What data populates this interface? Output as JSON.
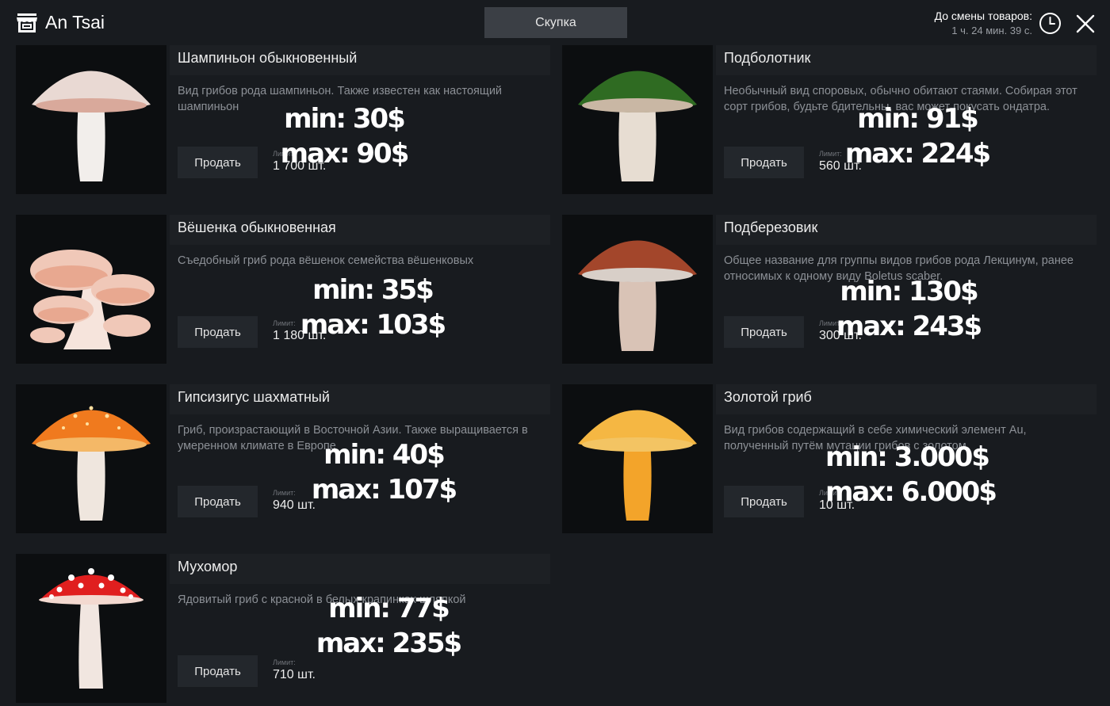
{
  "header": {
    "store_name": "An Tsai",
    "tab_label": "Скупка",
    "timer_label": "До смены товаров:",
    "timer_value": "1 ч. 24 мин. 39 с."
  },
  "icons": {
    "store": "store-icon",
    "clock": "clock-icon",
    "close": "close-icon"
  },
  "common": {
    "sell_label": "Продать",
    "limit_label": "Лимит:"
  },
  "items": [
    {
      "title": "Шампиньон обыкновенный",
      "description": "Вид грибов рода шампиньон. Также известен как настоящий шампиньон",
      "limit": "1 700 шт.",
      "min": "min: 30$",
      "max": "max: 90$",
      "cap_color": "#e9d9d3",
      "gill_color": "#d9a99b",
      "stem_color": "#f2eeeb",
      "image": "champignon"
    },
    {
      "title": "Подболотник",
      "description": "Необычный вид споровых, обычно обитают стаями. Собирая этот сорт грибов, будьте бдительны, вас может покусать ондатра.",
      "limit": "560 шт.",
      "min": "min: 91$",
      "max": "max: 224$",
      "cap_color": "#2f6b22",
      "gill_color": "#c9b7a4",
      "stem_color": "#e7ddd2",
      "image": "green-cap"
    },
    {
      "title": "Вёшенка обыкновенная",
      "description": "Съедобный гриб рода вёшенок семейства вёшенковых",
      "limit": "1 180 шт.",
      "min": "min: 35$",
      "max": "max: 103$",
      "cap_color": "#f0c8b8",
      "gill_color": "#e8a890",
      "stem_color": "#f6e4dc",
      "image": "oyster"
    },
    {
      "title": "Подберезовик",
      "description": "Общее название для группы видов грибов рода Лекцинум, ранее относимых к одному виду Boletus scaber.",
      "limit": "300 шт.",
      "min": "min: 130$",
      "max": "max: 243$",
      "cap_color": "#a3462b",
      "gill_color": "#d8cfc8",
      "stem_color": "#d9c3b6",
      "image": "birch-bolete"
    },
    {
      "title": "Гипсизигус шахматный",
      "description": "Гриб, произрастающий в Восточной Азии. Также выращивается в умеренном климате в Европе",
      "limit": "940 шт.",
      "min": "min: 40$",
      "max": "max: 107$",
      "cap_color": "#f07a1e",
      "gill_color": "#f4b867",
      "stem_color": "#efe6de",
      "image": "orange-cap"
    },
    {
      "title": "Золотой гриб",
      "description": "Вид грибов содержащий в себе химический элемент Au, полученный путём мутации грибов с золотом.",
      "limit": "10 шт.",
      "min": "min: 3.000$",
      "max": "max: 6.000$",
      "cap_color": "#f5b743",
      "gill_color": "#f3c463",
      "stem_color": "#f3a42a",
      "image": "golden"
    },
    {
      "title": "Мухомор",
      "description": "Ядовитый гриб с красной в белых крапинках шляпкой",
      "limit": "710 шт.",
      "min": "min: 77$",
      "max": "max: 235$",
      "cap_color": "#e01f1f",
      "gill_color": "#f3d9d0",
      "stem_color": "#f1e6e0",
      "image": "fly-agaric"
    }
  ]
}
